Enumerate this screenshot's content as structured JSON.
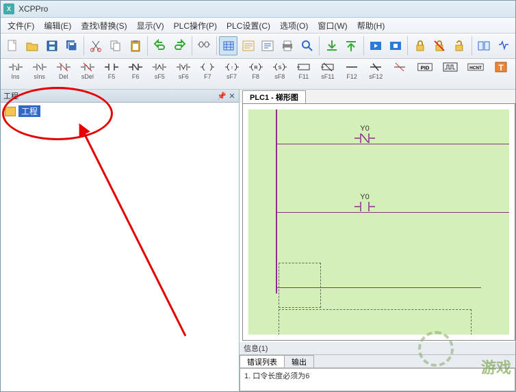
{
  "window": {
    "title": "XCPPro"
  },
  "menu": {
    "file": "文件(F)",
    "edit": "编辑(E)",
    "find": "查找\\替换(S)",
    "view": "显示(V)",
    "plcop": "PLC操作(P)",
    "plcset": "PLC设置(C)",
    "option": "选项(O)",
    "window": "窗口(W)",
    "help": "帮助(H)"
  },
  "toolbar": {
    "new": "new-file",
    "open": "open-file",
    "save": "save",
    "saveall": "save-all",
    "cut": "cut",
    "copy": "copy",
    "paste": "paste",
    "undo": "undo",
    "redo": "redo",
    "find": "find",
    "ladder": "ladder-view",
    "mnemonic": "mnemonic-view",
    "comment": "comment-edit",
    "config": "config",
    "check": "check",
    "download": "download",
    "upload": "upload",
    "run": "run",
    "stop": "stop",
    "lock": "lock",
    "unlock": "unlock",
    "lockopen": "lock-open",
    "compare": "compare",
    "print": "print"
  },
  "fnbar": {
    "items": [
      {
        "label": "Ins",
        "icon": "contact-no"
      },
      {
        "label": "sIns",
        "icon": "contact-no-p"
      },
      {
        "label": "Del",
        "icon": "contact-del"
      },
      {
        "label": "sDel",
        "icon": "contact-del-p"
      },
      {
        "label": "F5",
        "icon": "no"
      },
      {
        "label": "F6",
        "icon": "nc"
      },
      {
        "label": "sF5",
        "icon": "no-p"
      },
      {
        "label": "sF6",
        "icon": "nc-p"
      },
      {
        "label": "F7",
        "icon": "coil"
      },
      {
        "label": "sF7",
        "icon": "rising"
      },
      {
        "label": "F8",
        "icon": "reset"
      },
      {
        "label": "sF8",
        "icon": "set"
      },
      {
        "label": "F11",
        "icon": "hline"
      },
      {
        "label": "sF11",
        "icon": "hdel"
      },
      {
        "label": "F12",
        "icon": "vline"
      },
      {
        "label": "sF12",
        "icon": "vdel"
      },
      {
        "label": "",
        "icon": "hdelline"
      },
      {
        "label": "PID",
        "icon": "pid",
        "boxed": true
      },
      {
        "label": "",
        "icon": "pulse",
        "boxed": true
      },
      {
        "label": "",
        "icon": "hcnt",
        "boxed": true,
        "text": "HCNT"
      },
      {
        "label": "",
        "icon": "t",
        "boxed": true,
        "accent": true,
        "text": "T"
      }
    ]
  },
  "left": {
    "title": "工程",
    "pin": "📌",
    "close": "✕",
    "tree": {
      "root": "工程"
    }
  },
  "main": {
    "tab": "PLC1 - 梯形图",
    "contacts": {
      "y0a": "Y0",
      "y0b": "Y0"
    }
  },
  "info": {
    "header": "信息(1)",
    "tab1": "错误列表",
    "tab2": "输出",
    "line1": "1. 口令长度必须为6"
  },
  "watermark": "游戏"
}
